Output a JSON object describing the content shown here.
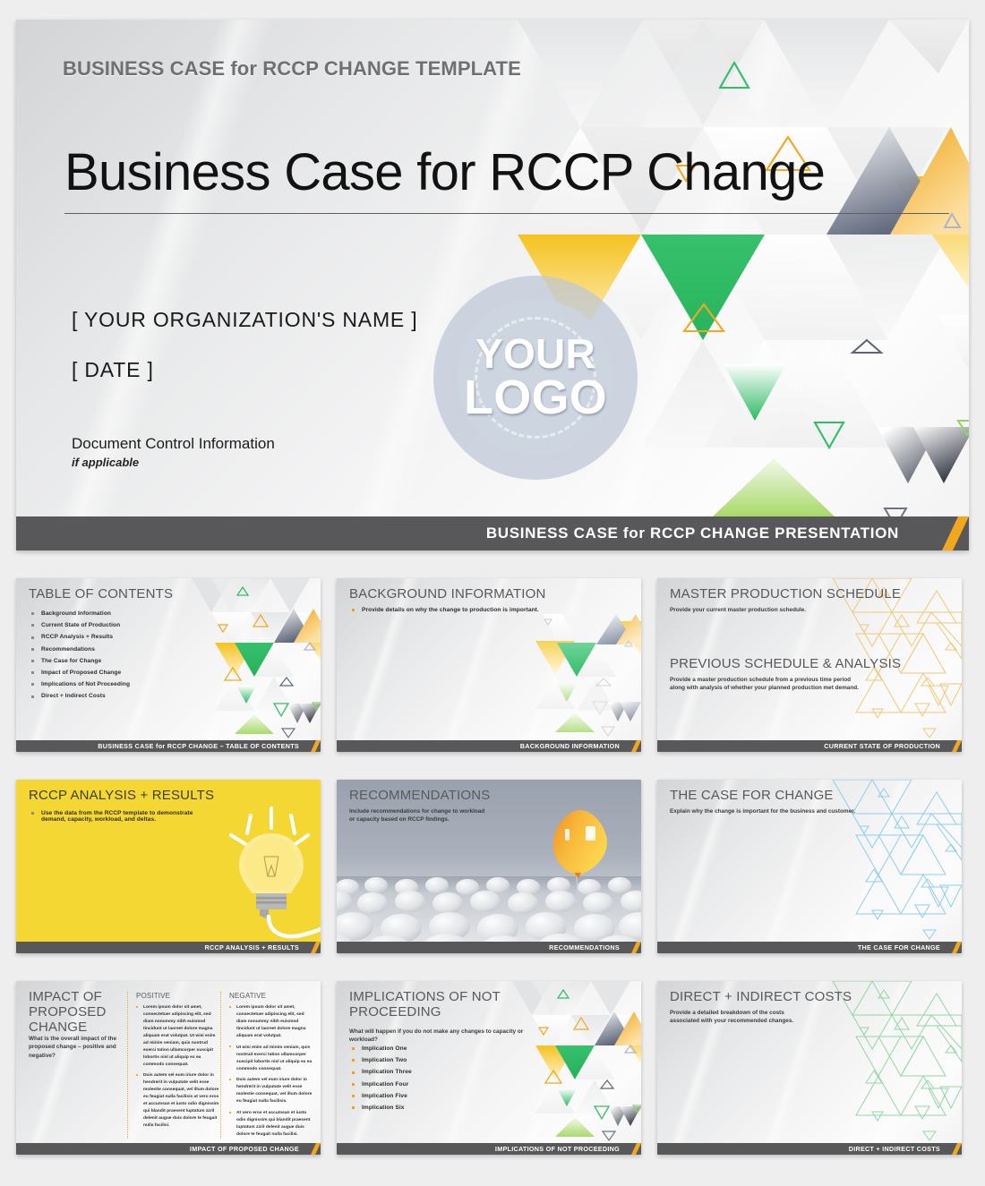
{
  "document": {
    "kicker": "BUSINESS CASE for RCCP CHANGE TEMPLATE",
    "title": "Business Case for RCCP Change",
    "organization": "[ YOUR ORGANIZATION'S NAME ]",
    "date": "[ DATE ]",
    "doc_control": "Document Control Information",
    "doc_control_note": "if applicable",
    "logo_line1": "YOUR",
    "logo_line2": "LOGO",
    "footer": "BUSINESS CASE for RCCP CHANGE PRESENTATION"
  },
  "colors": {
    "accent_yellow": "#f2a81d",
    "accent_green": "#2fbf67",
    "accent_amber_fill": "#f5c73b",
    "slide_yellow": "#f5d733",
    "footer_gray": "#58585a",
    "title_gray": "#58585a",
    "page_bg": "#eeeeee",
    "logo_ring": "#bcc6d6",
    "outline_blue": "#8ecdee",
    "outline_green": "#92d6a6"
  },
  "slides": [
    {
      "id": "table-of-contents",
      "title": "TABLE OF CONTENTS",
      "footer": "BUSINESS CASE for RCCP CHANGE  –  TABLE OF CONTENTS",
      "items": [
        "Background Information",
        "Current State of Production",
        "RCCP Analysis + Results",
        "Recommendations",
        "The Case for Change",
        "Impact of Proposed Change",
        "Implications of Not Proceeding",
        "Direct + Indirect Costs"
      ]
    },
    {
      "id": "background-information",
      "title": "BACKGROUND INFORMATION",
      "footer": "BACKGROUND INFORMATION",
      "items": [
        "Provide details on why the change to production is important."
      ]
    },
    {
      "id": "master-production-schedule",
      "title": "MASTER PRODUCTION SCHEDULE",
      "subtitle": "Provide your current master production schedule.",
      "title2": "PREVIOUS SCHEDULE & ANALYSIS",
      "subtitle2": "Provide a master production schedule from a previous time period along with analysis of whether your planned production met demand.",
      "footer": "CURRENT STATE OF PRODUCTION"
    },
    {
      "id": "rccp-analysis-results",
      "title": "RCCP ANALYSIS + RESULTS",
      "footer": "RCCP ANALYSIS + RESULTS",
      "items": [
        "Use the data from the RCCP template to demonstrate demand, capacity, workload, and deltas."
      ]
    },
    {
      "id": "recommendations",
      "title": "RECOMMENDATIONS",
      "subtitle": "Include recommendations for change to workload or capacity based on RCCP findings.",
      "footer": "RECOMMENDATIONS"
    },
    {
      "id": "the-case-for-change",
      "title": "THE CASE FOR CHANGE",
      "subtitle": "Explain why the change is important for the business and customer.",
      "footer": "THE CASE FOR CHANGE"
    },
    {
      "id": "impact-of-proposed-change",
      "title": "IMPACT OF PROPOSED CHANGE",
      "subtitle": "What is the overall impact of the proposed change – positive and negative?",
      "footer": "IMPACT OF PROPOSED CHANGE",
      "col_positive_heading": "POSITIVE",
      "col_negative_heading": "NEGATIVE",
      "col_positive": [
        "Lorem ipsum dolor sit amet, consectetuer adipiscing elit, sed diam nonummy nibh euismod tincidunt ut laoreet dolore magna aliquam erat volutpat. Ut wisi enim ad minim veniam, quis nostrud exerci tation ullamcorper suscipit lobortis nisl ut aliquip ex ea commodo consequat.",
        "Duis autem vel eum iriure dolor in hendrerit in vulputate velit esse molestie consequat, vel illum dolore eu feugiat nulla facilisis at vero eros et accumsan et iusto odio dignissim qui blandit praesent luptatum zzril delenit augue duis dolore te feugait nulla facilisi."
      ],
      "col_negative": [
        "Lorem ipsum dolor sit amet, consectetuer adipiscing elit, sed diam nonummy nibh euismod tincidunt ut laoreet dolore magna aliquam erat volutpat.",
        "Ut wisi enim ad minim veniam, quis nostrud exerci tation ullamcorper suscipit lobortis nisl ut aliquip ex ea commodo consequat.",
        "Duis autem vel eum iriure dolor in hendrerit in vulputate velit esse molestie consequat, vel illum dolore eu feugiat nulla facilisis.",
        "At vero eros et accumsan et iusto odio dignissim qui blandit praesent luptatum zzril delenit augue duis dolore te feugait nulla facilisi."
      ]
    },
    {
      "id": "implications-of-not-proceeding",
      "title": "IMPLICATIONS OF NOT PROCEEDING",
      "subtitle": "What will happen if you do not make any changes to capacity or workload?",
      "footer": "IMPLICATIONS OF NOT PROCEEDING",
      "items": [
        "Implication One",
        "Implication Two",
        "Implication Three",
        "Implication Four",
        "Implication Five",
        "Implication Six"
      ]
    },
    {
      "id": "direct-indirect-costs",
      "title": "DIRECT + INDIRECT COSTS",
      "subtitle": "Provide a detailed breakdown of the costs associated with your recommended changes.",
      "footer": "DIRECT + INDIRECT COSTS"
    }
  ]
}
